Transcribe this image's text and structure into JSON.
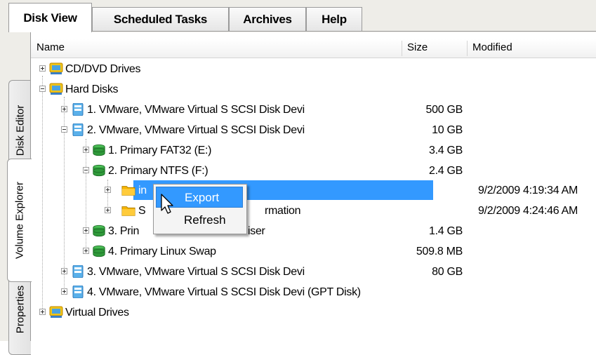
{
  "tabs": [
    {
      "label": "Disk View",
      "active": true
    },
    {
      "label": "Scheduled Tasks",
      "active": false
    },
    {
      "label": "Archives",
      "active": false
    },
    {
      "label": "Help",
      "active": false
    }
  ],
  "side_tabs": [
    {
      "label": "Disk Editor",
      "active": false
    },
    {
      "label": "Volume Explorer",
      "active": true
    },
    {
      "label": "Properties",
      "active": false
    }
  ],
  "columns": {
    "name": "Name",
    "size": "Size",
    "modified": "Modified"
  },
  "rows": [
    {
      "label": "CD/DVD Drives",
      "size": "",
      "modified": "",
      "icon": "drive-group-icon",
      "expanded": false
    },
    {
      "label": "Hard Disks",
      "size": "",
      "modified": "",
      "icon": "drive-group-icon",
      "expanded": true
    },
    {
      "label": "1. VMware, VMware Virtual S SCSI Disk Devi",
      "size": "500 GB",
      "modified": "",
      "icon": "disk-icon",
      "expanded": false
    },
    {
      "label": "2. VMware, VMware Virtual S SCSI Disk Devi",
      "size": "10 GB",
      "modified": "",
      "icon": "disk-icon",
      "expanded": true
    },
    {
      "label": "1. Primary FAT32 (E:)",
      "size": "3.4 GB",
      "modified": "",
      "icon": "volume-icon",
      "expanded": false
    },
    {
      "label": "2. Primary NTFS (F:)",
      "size": "2.4 GB",
      "modified": "",
      "icon": "volume-icon",
      "expanded": true
    },
    {
      "label": "in",
      "size": "",
      "modified": "9/2/2009 4:19:34 AM",
      "icon": "folder-icon",
      "expanded": false,
      "selected": true
    },
    {
      "label": "S",
      "label_tail": "rmation",
      "size": "",
      "modified": "9/2/2009 4:24:46 AM",
      "icon": "folder-icon",
      "expanded": false
    },
    {
      "label": "3. Prin",
      "label_tail": "iser",
      "size": "1.4 GB",
      "modified": "",
      "icon": "volume-icon",
      "expanded": false
    },
    {
      "label": "4. Primary Linux Swap",
      "size": "509.8 MB",
      "modified": "",
      "icon": "volume-icon",
      "expanded": false
    },
    {
      "label": "3. VMware, VMware Virtual S SCSI Disk Devi",
      "size": "80 GB",
      "modified": "",
      "icon": "disk-icon",
      "expanded": false
    },
    {
      "label": "4. VMware, VMware Virtual S SCSI Disk Devi (GPT Disk)",
      "size": "",
      "modified": "",
      "icon": "disk-icon",
      "expanded": false
    },
    {
      "label": "Virtual Drives",
      "size": "",
      "modified": "",
      "icon": "drive-group-icon",
      "expanded": false
    }
  ],
  "context_menu": {
    "items": [
      {
        "label": "Export",
        "hover": true
      },
      {
        "label": "Refresh",
        "hover": false
      }
    ]
  },
  "colors": {
    "selection": "#3399ff",
    "chrome": "#eeede8",
    "volume_green": "#2f9a3a",
    "disk_blue": "#4aa3e0",
    "folder": "#f5b400"
  }
}
